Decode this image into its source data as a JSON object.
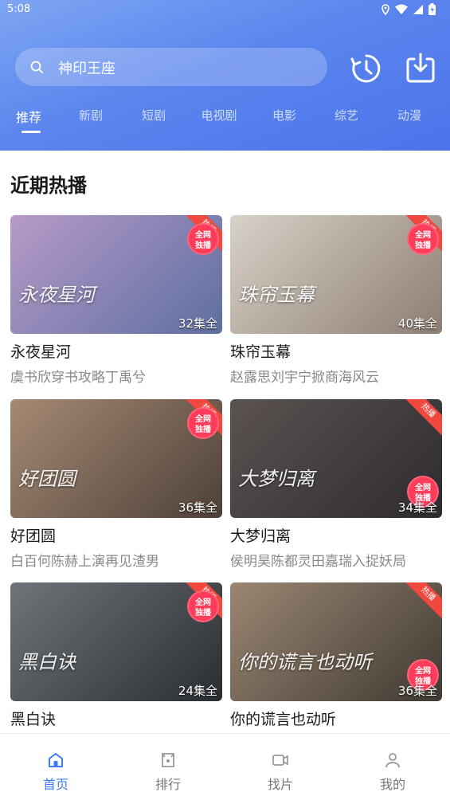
{
  "status_bar": {
    "time": "5:08"
  },
  "search": {
    "text": "神印王座"
  },
  "tabs": [
    {
      "label": "推荐",
      "active": true
    },
    {
      "label": "新剧"
    },
    {
      "label": "短剧"
    },
    {
      "label": "电视剧"
    },
    {
      "label": "电影"
    },
    {
      "label": "综艺"
    },
    {
      "label": "动漫"
    }
  ],
  "section": {
    "title": "近期热播"
  },
  "badges": {
    "hot": "热播",
    "network_line1": "全网",
    "network_line2": "独播"
  },
  "cards": [
    {
      "title": "永夜星河",
      "subtitle": "虞书欣穿书攻略丁禹兮",
      "episodes": "32集全",
      "logo": "永夜星河",
      "colors": [
        "#b79ac8",
        "#5e6fa0"
      ]
    },
    {
      "title": "珠帘玉幕",
      "subtitle": "赵露思刘宇宁掀商海风云",
      "episodes": "40集全",
      "logo": "珠帘玉幕",
      "colors": [
        "#d8d2c8",
        "#8d7e74"
      ]
    },
    {
      "title": "好团圆",
      "subtitle": "白百何陈赫上演再见渣男",
      "episodes": "36集全",
      "logo": "好团圆",
      "colors": [
        "#a58a74",
        "#4e4038"
      ]
    },
    {
      "title": "大梦归离",
      "subtitle": "侯明昊陈都灵田嘉瑞入捉妖局",
      "episodes": "34集全",
      "logo": "大梦归离",
      "colors": [
        "#5b5350",
        "#2d2a30"
      ]
    },
    {
      "title": "黑白诀",
      "subtitle": "",
      "episodes": "24集全",
      "logo": "黑白诀",
      "colors": [
        "#6e7478",
        "#2a2e33"
      ]
    },
    {
      "title": "你的谎言也动听",
      "subtitle": "",
      "episodes": "36集全",
      "logo": "你的谎言也动听",
      "colors": [
        "#9b8672",
        "#3f3a33"
      ]
    }
  ],
  "bottom_nav": [
    {
      "label": "首页",
      "icon": "home-icon",
      "active": true
    },
    {
      "label": "排行",
      "icon": "ranking-icon"
    },
    {
      "label": "找片",
      "icon": "video-icon"
    },
    {
      "label": "我的",
      "icon": "user-icon"
    }
  ],
  "colors": {
    "header_start": "#7ea6f3",
    "header_end": "#4b74ea",
    "accent": "#3e7bfa",
    "hot_ribbon": "#f0483e"
  }
}
